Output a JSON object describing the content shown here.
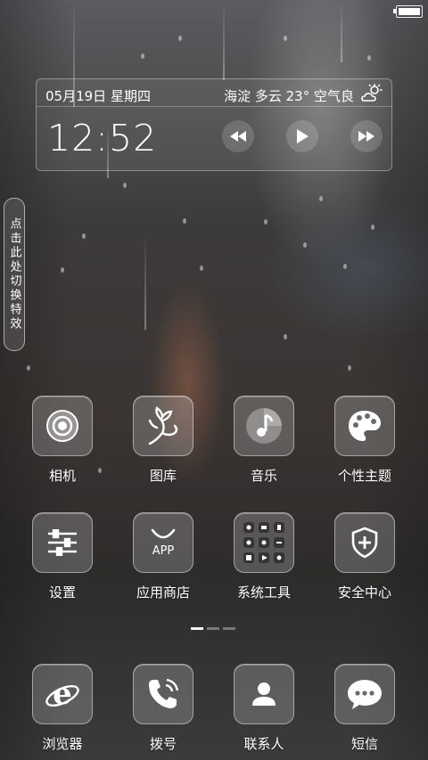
{
  "status_bar": {
    "battery_icon": "battery-full-icon"
  },
  "widget": {
    "date": "05月19日 星期四",
    "weather": "海淀 多云 23° 空气良",
    "weather_icon": "partly-cloudy-icon",
    "time": "12:52",
    "controls": [
      "rewind-icon",
      "play-icon",
      "fast-forward-icon"
    ]
  },
  "side_tab": {
    "label": "点击此处切换特效"
  },
  "apps_row1": [
    {
      "label": "相机",
      "icon": "camera-icon"
    },
    {
      "label": "图库",
      "icon": "gallery-flower-icon"
    },
    {
      "label": "音乐",
      "icon": "music-note-icon"
    },
    {
      "label": "个性主题",
      "icon": "theme-palette-icon"
    }
  ],
  "apps_row2": [
    {
      "label": "设置",
      "icon": "settings-sliders-icon"
    },
    {
      "label": "应用商店",
      "icon": "app-store-bag-icon",
      "badge_text": "APP"
    },
    {
      "label": "系统工具",
      "icon": "system-tools-grid-icon"
    },
    {
      "label": "安全中心",
      "icon": "security-shield-icon"
    }
  ],
  "page_indicator": {
    "count": 3,
    "active": 0
  },
  "dock": [
    {
      "label": "浏览器",
      "icon": "browser-e-icon"
    },
    {
      "label": "拨号",
      "icon": "phone-dialer-icon"
    },
    {
      "label": "联系人",
      "icon": "contacts-person-icon"
    },
    {
      "label": "短信",
      "icon": "messages-bubble-icon"
    }
  ]
}
